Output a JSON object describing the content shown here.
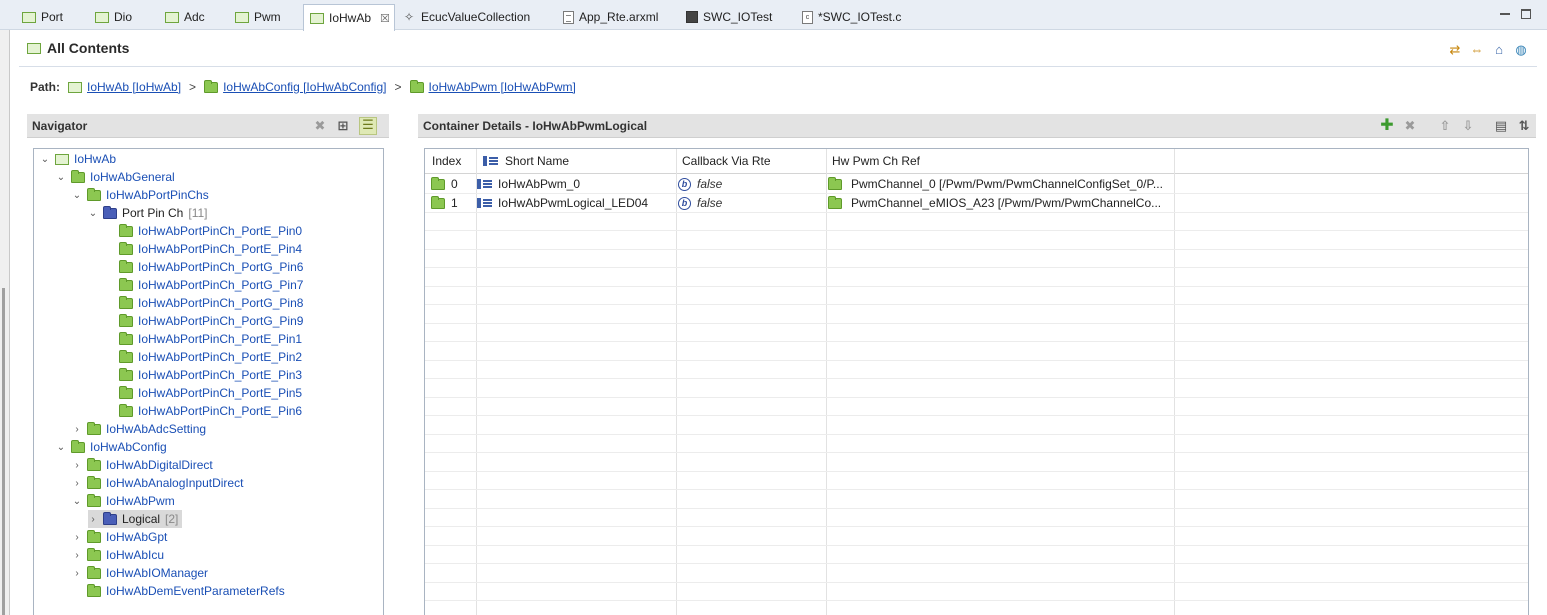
{
  "tabs": [
    {
      "label": "Port",
      "icon": "module-icon"
    },
    {
      "label": "Dio",
      "icon": "module-icon"
    },
    {
      "label": "Adc",
      "icon": "module-icon"
    },
    {
      "label": "Pwm",
      "icon": "module-icon"
    },
    {
      "label": "IoHwAb",
      "icon": "module-icon",
      "active": true,
      "close": "☒"
    },
    {
      "label": "EcucValueCollection",
      "icon": "gear-icon"
    },
    {
      "label": "App_Rte.arxml",
      "icon": "document-icon"
    },
    {
      "label": "SWC_IOTest",
      "icon": "component-icon"
    },
    {
      "label": "*SWC_IOTest.c",
      "icon": "c-file-icon"
    }
  ],
  "header": {
    "title": "All Contents"
  },
  "path": {
    "label": "Path:",
    "crumbs": [
      "IoHwAb [IoHwAb]",
      "IoHwAbConfig [IoHwAbConfig]",
      "IoHwAbPwm [IoHwAbPwm]"
    ],
    "separator": ">"
  },
  "navigator": {
    "title": "Navigator",
    "tree": [
      {
        "label": "IoHwAb",
        "depth": 0,
        "expanded": true,
        "icon": "module-icon"
      },
      {
        "label": "IoHwAbGeneral",
        "depth": 1,
        "expanded": true,
        "icon": "folder-icon"
      },
      {
        "label": "IoHwAbPortPinChs",
        "depth": 2,
        "expanded": true,
        "icon": "folder-icon"
      },
      {
        "label": "Port Pin Ch",
        "count": "[11]",
        "depth": 3,
        "expanded": true,
        "icon": "blue-folder-icon"
      },
      {
        "label": "IoHwAbPortPinCh_PortE_Pin0",
        "depth": 4,
        "icon": "folder-icon"
      },
      {
        "label": "IoHwAbPortPinCh_PortE_Pin4",
        "depth": 4,
        "icon": "folder-icon"
      },
      {
        "label": "IoHwAbPortPinCh_PortG_Pin6",
        "depth": 4,
        "icon": "folder-icon"
      },
      {
        "label": "IoHwAbPortPinCh_PortG_Pin7",
        "depth": 4,
        "icon": "folder-icon"
      },
      {
        "label": "IoHwAbPortPinCh_PortG_Pin8",
        "depth": 4,
        "icon": "folder-icon"
      },
      {
        "label": "IoHwAbPortPinCh_PortG_Pin9",
        "depth": 4,
        "icon": "folder-icon"
      },
      {
        "label": "IoHwAbPortPinCh_PortE_Pin1",
        "depth": 4,
        "icon": "folder-icon"
      },
      {
        "label": "IoHwAbPortPinCh_PortE_Pin2",
        "depth": 4,
        "icon": "folder-icon"
      },
      {
        "label": "IoHwAbPortPinCh_PortE_Pin3",
        "depth": 4,
        "icon": "folder-icon"
      },
      {
        "label": "IoHwAbPortPinCh_PortE_Pin5",
        "depth": 4,
        "icon": "folder-icon"
      },
      {
        "label": "IoHwAbPortPinCh_PortE_Pin6",
        "depth": 4,
        "icon": "folder-icon"
      },
      {
        "label": "IoHwAbAdcSetting",
        "depth": 2,
        "expanded": false,
        "icon": "folder-icon"
      },
      {
        "label": "IoHwAbConfig",
        "depth": 1,
        "expanded": true,
        "icon": "folder-icon"
      },
      {
        "label": "IoHwAbDigitalDirect",
        "depth": 2,
        "expanded": false,
        "icon": "folder-icon"
      },
      {
        "label": "IoHwAbAnalogInputDirect",
        "depth": 2,
        "expanded": false,
        "icon": "folder-icon"
      },
      {
        "label": "IoHwAbPwm",
        "depth": 2,
        "expanded": true,
        "icon": "folder-icon"
      },
      {
        "label": "Logical",
        "count": "[2]",
        "depth": 3,
        "expanded": false,
        "selected": true,
        "icon": "blue-folder-icon"
      },
      {
        "label": "IoHwAbGpt",
        "depth": 2,
        "expanded": false,
        "icon": "folder-icon"
      },
      {
        "label": "IoHwAbIcu",
        "depth": 2,
        "expanded": false,
        "icon": "folder-icon"
      },
      {
        "label": "IoHwAbIOManager",
        "depth": 2,
        "expanded": false,
        "icon": "folder-icon"
      },
      {
        "label": "IoHwAbDemEventParameterRefs",
        "depth": 2,
        "icon": "folder-icon"
      }
    ]
  },
  "details": {
    "title": "Container Details - IoHwAbPwmLogical",
    "columns": [
      "Index",
      "Short Name",
      "Callback Via Rte",
      "Hw Pwm Ch Ref"
    ],
    "rows": [
      {
        "index": "0",
        "short_name": "IoHwAbPwm_0",
        "callback": "false",
        "ref": "PwmChannel_0 [/Pwm/Pwm/PwmChannelConfigSet_0/P..."
      },
      {
        "index": "1",
        "short_name": "IoHwAbPwmLogical_LED04",
        "callback": "false",
        "ref": "PwmChannel_eMIOS_A23 [/Pwm/Pwm/PwmChannelCo..."
      }
    ]
  }
}
